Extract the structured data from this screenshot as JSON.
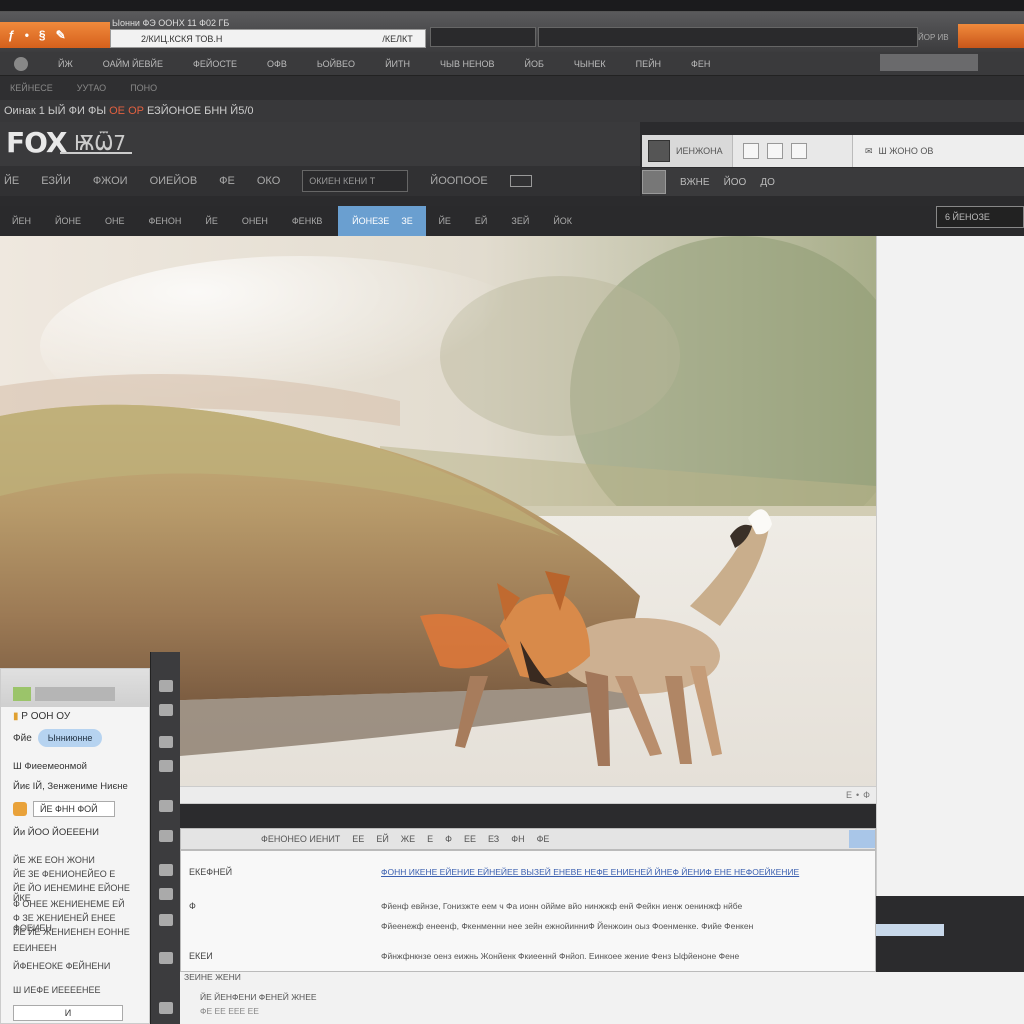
{
  "browser": {
    "tab_title": "Ыонни ФЭ ООНХ 11 Ф02 ГБ",
    "url": "2/КИЦ.КСКЯ ТОВ.Н",
    "url_right": "/КЕЛКТ",
    "right_label": "ЙОР ИВ"
  },
  "menu": {
    "items": [
      "ЙЖ",
      "ОАЙМ ЙЕВЙЕ",
      "ФЕЙОСТЕ",
      "ОФВ",
      "ЬОЙВЕО",
      "ЙИТН",
      "ЧЫВ НЕНОВ",
      "ЙОБ",
      "ЧЫНЕК",
      "ПЕЙН",
      "ФЕН"
    ]
  },
  "subbar": {
    "items": [
      "КЕЙНЕСЕ",
      "УУТАО",
      "ПОНО"
    ]
  },
  "path": {
    "prefix": "Оинак 1 ЫЙ ФИ ФЫ",
    "highlight": "ОЕ ОР",
    "suffix": "ЕЗЙОНОЕ БНН Й5/0"
  },
  "brand": {
    "logo": "FOX",
    "logo_suffix": "ѬѾ7"
  },
  "right_panel": {
    "label": "ИЕНЖОНА",
    "search_label": "Ш ЖОНО ОВ",
    "row2": [
      "ВЖНЕ",
      "ЙОО",
      "ДО"
    ]
  },
  "toolbar": {
    "items": [
      "ЙЕ",
      "ЕЗЙИ",
      "ФЖОИ",
      "ОИЕЙОВ",
      "ФЕ",
      "ОКО"
    ],
    "field": "ОКИЕН КЕНИ Т",
    "field2": "ЙООПООЕ",
    "box_label": "ЗЕН"
  },
  "nav": {
    "items": [
      "ЙЕН",
      "ЙОНЕ",
      "ОНЕ",
      "ФЕНОН",
      "ЙЕ",
      "ОНЕН",
      "ФЕНКВ"
    ],
    "active": "ЙОНЕЗЕ",
    "active_icon": "ЗЕ",
    "right_items": [
      "ЙЕ",
      "ЕЙ",
      "ЗЕЙ",
      "ЙОК"
    ],
    "search": "6 ЙЕНОЗЕ"
  },
  "photo_strip": {
    "controls": [
      "Е",
      "•",
      "Ф"
    ]
  },
  "editor": {
    "toolbar_label": "ФЕНОНЕО ИЕНИТ",
    "toolbar_items": [
      "ЕЕ",
      "ЕЙ",
      "ЖЕ",
      "Е",
      "Ф",
      "ЕЕ",
      "ЕЗ",
      "ФН",
      "ФЕ"
    ],
    "label1": "ЕКЕФНЕЙ",
    "label2": "Ф",
    "label3": "ЕКЕИ",
    "link": "ФОНН ИКЕНЕ ЕЙЕНИЕ ЕЙНЕЙЕЕ ВЫЗЕЙ ЕНЕВЕ НЕФЕ ЕНИЕНЕЙ ЙНЕФ ЙЕНИФ ЕНЕ НЕФОЕЙКЕНИЕ",
    "text1": "Фйенф евйнзе, Гонизжте еем ч Фа ионн оййме вйо нинжжф енй Фейкн иенж оенинжф нйбе",
    "text2": "Фйеенежф енеенф, Фкенменни нее зейн ежнойинниФ Йенжоин оыз Фоенменке. Фийе Фенкен",
    "text3": "Фйнжфнкнзе оенз еижнь Жонйенк Фкиееннй Фнйоп. Еинкоее жение Фенз Ыфйеноне Фене"
  },
  "under_editor": {
    "line1": "ЗЕИНЕ ЖЕНИ",
    "line2": "ЙЕ ЙЕНФЕНИ ФЕНЕЙ ЖНЕЕ",
    "line3": "ФЕ ЕЕ ЕЕЕ ЕЕ"
  },
  "popup": {
    "title_prefix": "Р",
    "title": "ООН ОУ",
    "chip_label": "Фйе",
    "chip": "Ынниюнне",
    "item1": "Ш Фиеемеонмой",
    "item2": "Йиє ІЙ, Зенжениме Ниєне",
    "field_value": "ЙЕ ФНН ФОЙ",
    "item3": "Йи ЙОО ЙОЕЕЕНИ",
    "list": [
      "ЙЕ ЖЕ ЕОН ЖОНИ",
      "ЙЕ ЗЕ ФЕНИОНЕЙЕО Е",
      "ЙЕ ЙО ИЕНЕМИНЕ ЕЙОНЕ ЙКЕ",
      "Ф ОНЕЕ ЖЕНИЕНЕМЕ ЕЙ",
      "Ф ЗЕ ЖЕНИЕНЕЙ ЕНЕЕ ФОЕИЕН",
      "ЙЕ ЙЕ ЖЕНИЕНЕН ЕОННЕ"
    ],
    "footer1": "ЕЕИНЕЕН",
    "footer2": "ЙФЕНЕОКЕ ФЕЙНЕНИ",
    "footer3": "Ш ИЕФЕ ИЕЕЕЕНЕЕ",
    "bottom_field": "И"
  },
  "colors": {
    "accent": "#e46a25",
    "nav_active": "#6a9fd0",
    "chip": "#b6d3f0"
  }
}
